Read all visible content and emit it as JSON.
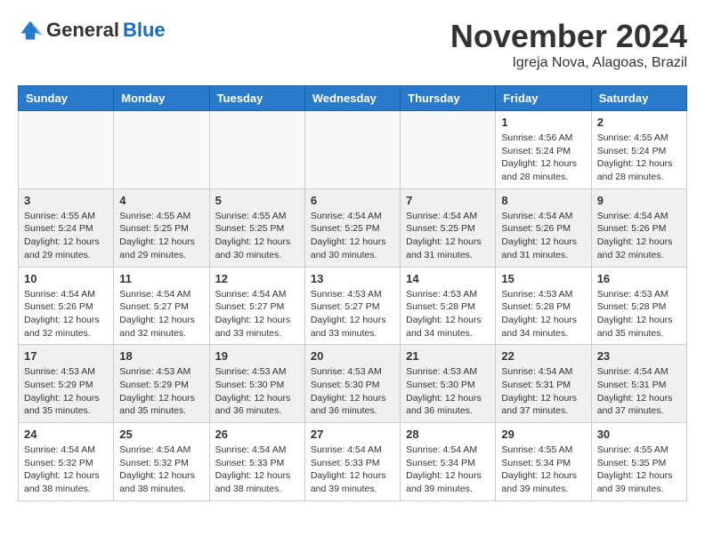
{
  "logo": {
    "general": "General",
    "blue": "Blue"
  },
  "title": "November 2024",
  "location": "Igreja Nova, Alagoas, Brazil",
  "weekdays": [
    "Sunday",
    "Monday",
    "Tuesday",
    "Wednesday",
    "Thursday",
    "Friday",
    "Saturday"
  ],
  "weeks": [
    [
      {
        "day": "",
        "info": ""
      },
      {
        "day": "",
        "info": ""
      },
      {
        "day": "",
        "info": ""
      },
      {
        "day": "",
        "info": ""
      },
      {
        "day": "",
        "info": ""
      },
      {
        "day": "1",
        "info": "Sunrise: 4:56 AM\nSunset: 5:24 PM\nDaylight: 12 hours and 28 minutes."
      },
      {
        "day": "2",
        "info": "Sunrise: 4:55 AM\nSunset: 5:24 PM\nDaylight: 12 hours and 28 minutes."
      }
    ],
    [
      {
        "day": "3",
        "info": "Sunrise: 4:55 AM\nSunset: 5:24 PM\nDaylight: 12 hours and 29 minutes."
      },
      {
        "day": "4",
        "info": "Sunrise: 4:55 AM\nSunset: 5:25 PM\nDaylight: 12 hours and 29 minutes."
      },
      {
        "day": "5",
        "info": "Sunrise: 4:55 AM\nSunset: 5:25 PM\nDaylight: 12 hours and 30 minutes."
      },
      {
        "day": "6",
        "info": "Sunrise: 4:54 AM\nSunset: 5:25 PM\nDaylight: 12 hours and 30 minutes."
      },
      {
        "day": "7",
        "info": "Sunrise: 4:54 AM\nSunset: 5:25 PM\nDaylight: 12 hours and 31 minutes."
      },
      {
        "day": "8",
        "info": "Sunrise: 4:54 AM\nSunset: 5:26 PM\nDaylight: 12 hours and 31 minutes."
      },
      {
        "day": "9",
        "info": "Sunrise: 4:54 AM\nSunset: 5:26 PM\nDaylight: 12 hours and 32 minutes."
      }
    ],
    [
      {
        "day": "10",
        "info": "Sunrise: 4:54 AM\nSunset: 5:26 PM\nDaylight: 12 hours and 32 minutes."
      },
      {
        "day": "11",
        "info": "Sunrise: 4:54 AM\nSunset: 5:27 PM\nDaylight: 12 hours and 32 minutes."
      },
      {
        "day": "12",
        "info": "Sunrise: 4:54 AM\nSunset: 5:27 PM\nDaylight: 12 hours and 33 minutes."
      },
      {
        "day": "13",
        "info": "Sunrise: 4:53 AM\nSunset: 5:27 PM\nDaylight: 12 hours and 33 minutes."
      },
      {
        "day": "14",
        "info": "Sunrise: 4:53 AM\nSunset: 5:28 PM\nDaylight: 12 hours and 34 minutes."
      },
      {
        "day": "15",
        "info": "Sunrise: 4:53 AM\nSunset: 5:28 PM\nDaylight: 12 hours and 34 minutes."
      },
      {
        "day": "16",
        "info": "Sunrise: 4:53 AM\nSunset: 5:28 PM\nDaylight: 12 hours and 35 minutes."
      }
    ],
    [
      {
        "day": "17",
        "info": "Sunrise: 4:53 AM\nSunset: 5:29 PM\nDaylight: 12 hours and 35 minutes."
      },
      {
        "day": "18",
        "info": "Sunrise: 4:53 AM\nSunset: 5:29 PM\nDaylight: 12 hours and 35 minutes."
      },
      {
        "day": "19",
        "info": "Sunrise: 4:53 AM\nSunset: 5:30 PM\nDaylight: 12 hours and 36 minutes."
      },
      {
        "day": "20",
        "info": "Sunrise: 4:53 AM\nSunset: 5:30 PM\nDaylight: 12 hours and 36 minutes."
      },
      {
        "day": "21",
        "info": "Sunrise: 4:53 AM\nSunset: 5:30 PM\nDaylight: 12 hours and 36 minutes."
      },
      {
        "day": "22",
        "info": "Sunrise: 4:54 AM\nSunset: 5:31 PM\nDaylight: 12 hours and 37 minutes."
      },
      {
        "day": "23",
        "info": "Sunrise: 4:54 AM\nSunset: 5:31 PM\nDaylight: 12 hours and 37 minutes."
      }
    ],
    [
      {
        "day": "24",
        "info": "Sunrise: 4:54 AM\nSunset: 5:32 PM\nDaylight: 12 hours and 38 minutes."
      },
      {
        "day": "25",
        "info": "Sunrise: 4:54 AM\nSunset: 5:32 PM\nDaylight: 12 hours and 38 minutes."
      },
      {
        "day": "26",
        "info": "Sunrise: 4:54 AM\nSunset: 5:33 PM\nDaylight: 12 hours and 38 minutes."
      },
      {
        "day": "27",
        "info": "Sunrise: 4:54 AM\nSunset: 5:33 PM\nDaylight: 12 hours and 39 minutes."
      },
      {
        "day": "28",
        "info": "Sunrise: 4:54 AM\nSunset: 5:34 PM\nDaylight: 12 hours and 39 minutes."
      },
      {
        "day": "29",
        "info": "Sunrise: 4:55 AM\nSunset: 5:34 PM\nDaylight: 12 hours and 39 minutes."
      },
      {
        "day": "30",
        "info": "Sunrise: 4:55 AM\nSunset: 5:35 PM\nDaylight: 12 hours and 39 minutes."
      }
    ]
  ]
}
